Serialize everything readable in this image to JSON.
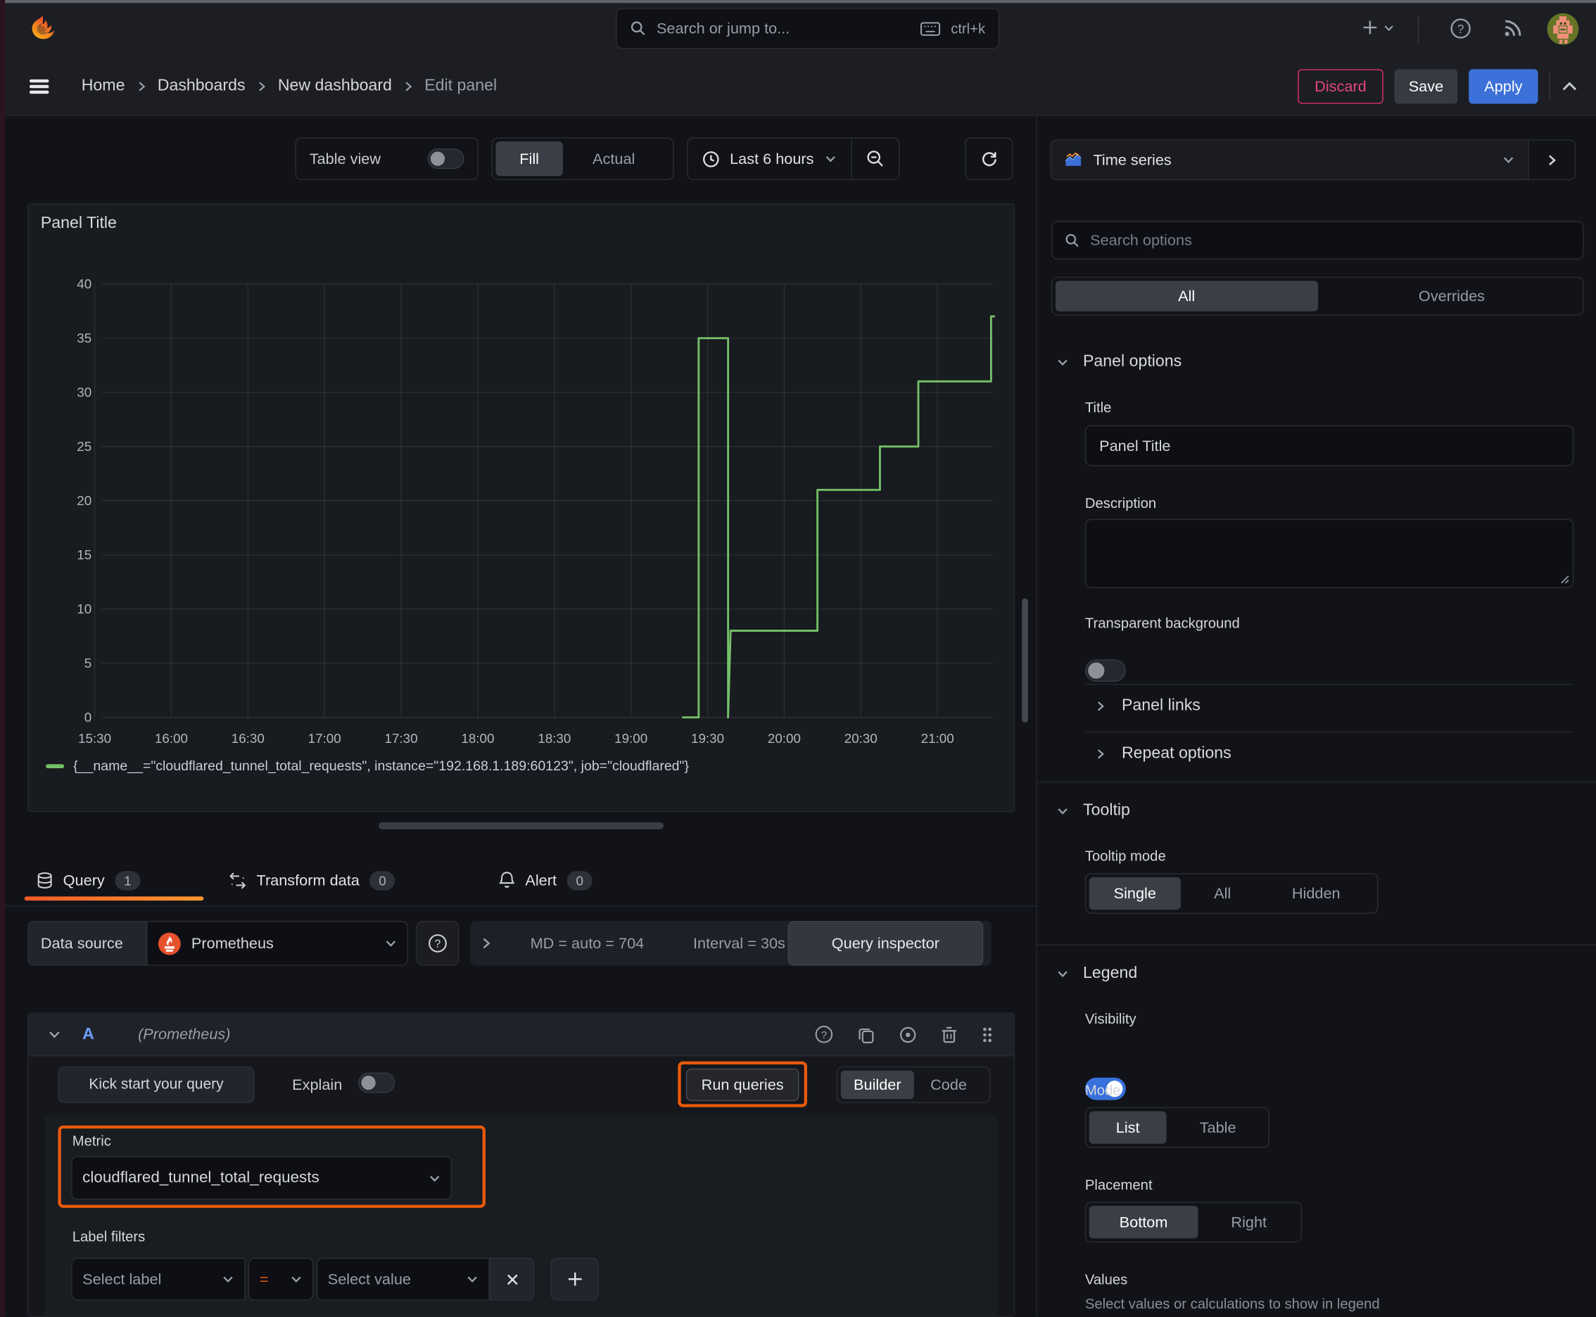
{
  "topbar": {
    "search_placeholder": "Search or jump to...",
    "shortcut": "ctrl+k"
  },
  "breadcrumb": {
    "items": [
      "Home",
      "Dashboards",
      "New dashboard",
      "Edit panel"
    ]
  },
  "actions": {
    "discard": "Discard",
    "save": "Save",
    "apply": "Apply"
  },
  "toolbar": {
    "table_view": "Table view",
    "fill": "Fill",
    "actual": "Actual",
    "time_range": "Last 6 hours"
  },
  "panel": {
    "title": "Panel Title"
  },
  "chart_data": {
    "type": "line",
    "title": "Panel Title",
    "x_tick_labels": [
      "15:30",
      "16:00",
      "16:30",
      "17:00",
      "17:30",
      "18:00",
      "18:30",
      "19:00",
      "19:30",
      "20:00",
      "20:30",
      "21:00"
    ],
    "y_ticks": [
      0,
      5,
      10,
      15,
      20,
      25,
      30,
      35,
      40
    ],
    "ylim": [
      0,
      40
    ],
    "xlim_minutes_from_1530": [
      -10,
      353
    ],
    "grid": true,
    "legend_position": "bottom",
    "series": [
      {
        "name": "{__name__=\"cloudflared_tunnel_total_requests\", instance=\"192.168.1.189:60123\", job=\"cloudflared\"}",
        "color": "#73bf69",
        "step": true,
        "points_minutes_value": [
          [
            230,
            0
          ],
          [
            236.5,
            0
          ],
          [
            236.5,
            35
          ],
          [
            248,
            35
          ],
          [
            248,
            0
          ],
          [
            249,
            8
          ],
          [
            283,
            8
          ],
          [
            283,
            21
          ],
          [
            307.5,
            21
          ],
          [
            307.5,
            25
          ],
          [
            322.5,
            25
          ],
          [
            322.5,
            31
          ],
          [
            351,
            31
          ],
          [
            351,
            37
          ],
          [
            352.5,
            37
          ]
        ]
      }
    ]
  },
  "tabs": {
    "query": "Query",
    "query_count": "1",
    "transform": "Transform data",
    "transform_count": "0",
    "alert": "Alert",
    "alert_count": "0"
  },
  "datasource": {
    "label": "Data source",
    "name": "Prometheus",
    "md": "MD = auto = 704",
    "interval": "Interval = 30s",
    "inspector": "Query inspector"
  },
  "query": {
    "ref": "A",
    "ds_hint": "(Prometheus)",
    "kickstart": "Kick start your query",
    "explain": "Explain",
    "run": "Run queries",
    "builder": "Builder",
    "code": "Code",
    "metric_label": "Metric",
    "metric_value": "cloudflared_tunnel_total_requests",
    "label_filters": "Label filters",
    "select_label": "Select label",
    "operator": "=",
    "select_value": "Select value"
  },
  "options": {
    "viz_type": "Time series",
    "search_placeholder": "Search options",
    "tab_all": "All",
    "tab_overrides": "Overrides",
    "panel_options": "Panel options",
    "title_label": "Title",
    "title_value": "Panel Title",
    "description_label": "Description",
    "transparent_bg": "Transparent background",
    "panel_links": "Panel links",
    "repeat_options": "Repeat options",
    "tooltip": "Tooltip",
    "tooltip_mode": "Tooltip mode",
    "single": "Single",
    "all": "All",
    "hidden": "Hidden",
    "legend": "Legend",
    "visibility": "Visibility",
    "mode": "Mode",
    "list": "List",
    "table": "Table",
    "placement": "Placement",
    "bottom": "Bottom",
    "right": "Right",
    "values": "Values",
    "values_hint": "Select values or calculations to show in legend"
  },
  "colors": {
    "accent_orange": "#ff780a",
    "highlight_orange": "#e9590c",
    "blue": "#3d71d9",
    "pink": "#e02f68",
    "green": "#73bf69"
  }
}
